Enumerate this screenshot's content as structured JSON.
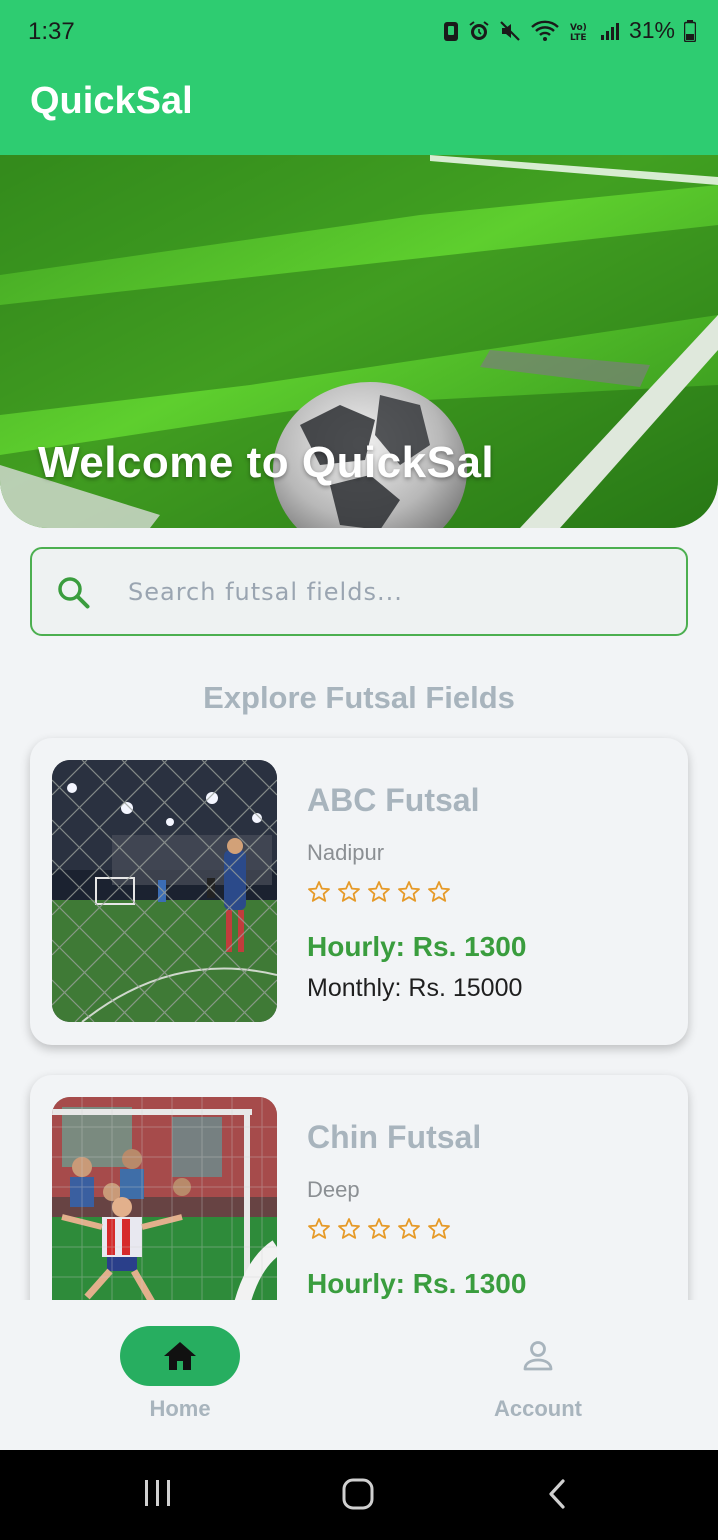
{
  "status_bar": {
    "time": "1:37",
    "battery_percent": "31%"
  },
  "app_bar": {
    "title": "QuickSal"
  },
  "hero": {
    "title": "Welcome to QuickSal"
  },
  "search": {
    "placeholder": "Search futsal fields...",
    "value": ""
  },
  "section": {
    "title": "Explore Futsal Fields"
  },
  "fields": [
    {
      "name": "ABC Futsal",
      "location": "Nadipur",
      "rating": 0,
      "hourly": "Hourly: Rs. 1300",
      "monthly": "Monthly: Rs. 15000"
    },
    {
      "name": "Chin Futsal",
      "location": "Deep",
      "rating": 0,
      "hourly": "Hourly: Rs. 1300",
      "monthly": ""
    }
  ],
  "bottom_nav": {
    "items": [
      {
        "label": "Home",
        "icon": "home-icon",
        "active": true
      },
      {
        "label": "Account",
        "icon": "account-icon",
        "active": false
      }
    ]
  },
  "colors": {
    "primary": "#2ecc71",
    "accent_green": "#3a9d3e",
    "star": "#e69a28",
    "muted_text": "#a8b4bd"
  }
}
